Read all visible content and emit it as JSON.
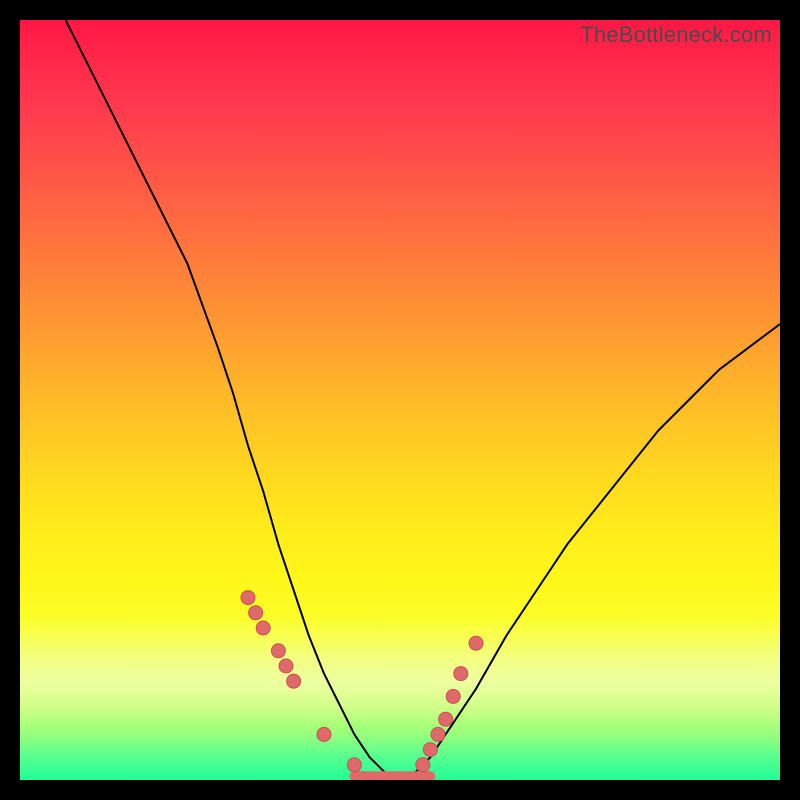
{
  "watermark": "TheBottleneck.com",
  "chart_data": {
    "type": "line",
    "title": "",
    "xlabel": "",
    "ylabel": "",
    "xlim": [
      0,
      100
    ],
    "ylim": [
      0,
      100
    ],
    "grid": false,
    "legend": false,
    "series": [
      {
        "name": "bottleneck-curve",
        "x": [
          6,
          10,
          14,
          18,
          22,
          26,
          28,
          30,
          32,
          34,
          36,
          38,
          40,
          42,
          44,
          46,
          48,
          50,
          52,
          54,
          56,
          60,
          64,
          68,
          72,
          76,
          80,
          84,
          88,
          92,
          96,
          100
        ],
        "y": [
          100,
          92,
          84,
          76,
          68,
          57,
          51,
          44,
          38,
          31,
          25,
          19,
          14,
          10,
          6,
          3,
          1,
          0,
          1,
          3,
          6,
          12,
          19,
          25,
          31,
          36,
          41,
          46,
          50,
          54,
          57,
          60
        ]
      }
    ],
    "annotations": [
      {
        "type": "flat-minimum",
        "x_range": [
          44,
          54
        ],
        "y": 0.5
      }
    ],
    "markers": {
      "name": "highlighted-points",
      "x": [
        30,
        31,
        32,
        34,
        35,
        36,
        40,
        44,
        53,
        54,
        55,
        56,
        57,
        58,
        60
      ],
      "y": [
        24,
        22,
        20,
        17,
        15,
        13,
        6,
        2,
        2,
        4,
        6,
        8,
        11,
        14,
        18
      ]
    }
  }
}
